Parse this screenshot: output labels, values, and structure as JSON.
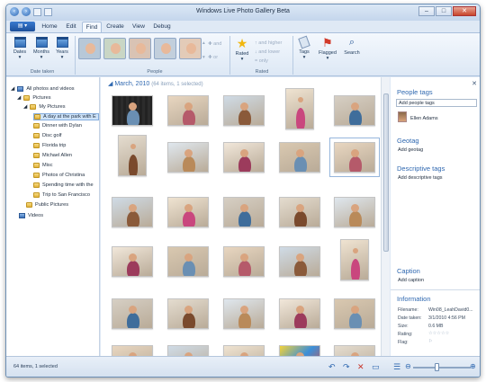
{
  "window": {
    "title": "Windows Live Photo Gallery Beta"
  },
  "ribbon": {
    "tabs": [
      "Home",
      "Edit",
      "Find",
      "Create",
      "View",
      "Debug"
    ],
    "active_tab": "Find",
    "date_taken": {
      "dates": "Dates",
      "months": "Months",
      "years": "Years",
      "group": "Date taken"
    },
    "people_group": "People",
    "people_actions": {
      "and": "and",
      "or": "or"
    },
    "rated": {
      "label": "Rated",
      "higher": "and higher",
      "lower": "and lower",
      "only": "only",
      "group": "Rated"
    },
    "tags": "Tags",
    "flagged": "Flagged",
    "search": "Search"
  },
  "nav": {
    "all": "All photos and videos",
    "pictures": "Pictures",
    "my_pictures": "My Pictures",
    "folders": [
      "A day at the park with E",
      "Dinner with Dylan",
      "Disc golf",
      "Florida trip",
      "Michael Allen",
      "Misc",
      "Photos of Christina",
      "Spending time with the",
      "Trip to San Francisco"
    ],
    "public": "Public Pictures",
    "videos": "Videos"
  },
  "grid": {
    "month": "March, 2010",
    "count": "(64 items, 1 selected)"
  },
  "pane": {
    "people_tags": "People tags",
    "add_people": "Add people tags",
    "person": "Ellen Adams",
    "geotag": "Geotag",
    "add_geotag": "Add geotag",
    "descriptive": "Descriptive tags",
    "add_descriptive": "Add descriptive tags",
    "caption": "Caption",
    "add_caption": "Add caption",
    "information": "Information",
    "info": {
      "filename_k": "Filename:",
      "filename_v": "Win08_LeahDavid0...",
      "date_k": "Date taken:",
      "date_v": "3/1/2010  4:56 PM",
      "size_k": "Size:",
      "size_v": "0.6 MB",
      "rating_k": "Rating:",
      "rating_v": "☆☆☆☆☆",
      "flag_k": "Flag:",
      "flag_v": "⚐"
    }
  },
  "status": {
    "text": "64 items, 1 selected"
  },
  "colors": {
    "accent": "#2f68b0",
    "selection": "#cfe3f8",
    "flag": "#d23a2a",
    "star": "#f1b70f"
  }
}
